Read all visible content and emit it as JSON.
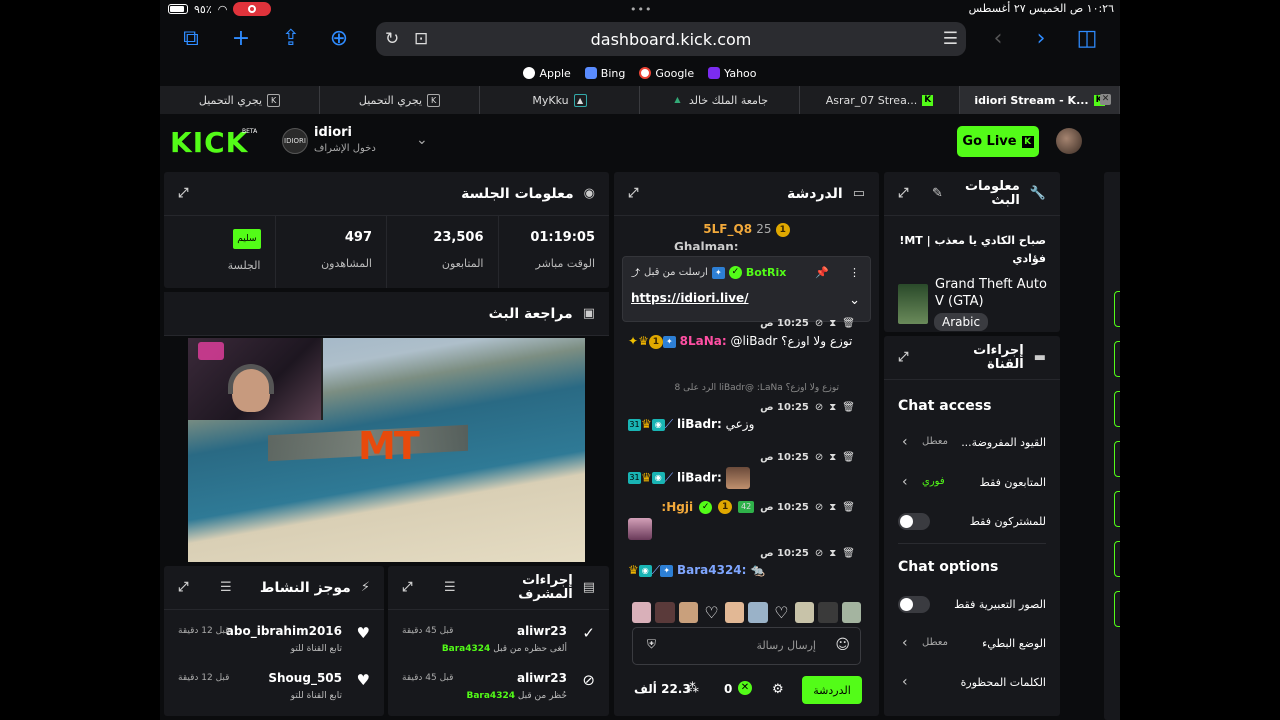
{
  "status": {
    "battery": "٩٥٪",
    "time_date": "١٠:٢٦ ص   الخميس ٢٧ أغسطس",
    "dots": "•••"
  },
  "browser": {
    "url": "dashboard.kick.com",
    "favorites": [
      {
        "label": "Apple",
        "color": "#ffffff"
      },
      {
        "label": "Bing",
        "color": "#5a8cff"
      },
      {
        "label": "Google",
        "color": "#ea4335"
      },
      {
        "label": "Yahoo",
        "color": "#7b2cf0"
      }
    ],
    "tabs": [
      {
        "label": "يجري التحميل"
      },
      {
        "label": "يجري التحميل"
      },
      {
        "label": "MyKku"
      },
      {
        "label": "جامعة الملك خالد"
      },
      {
        "label": "Asrar_07 Strea..."
      },
      {
        "label": "idiori Stream - K..."
      }
    ]
  },
  "header": {
    "logo": "KICK",
    "beta": "BETA",
    "channel_name": "idiori",
    "channel_sub": "دخول الإشراف",
    "avatar_text": "IDIORI",
    "go_live": "Go Live",
    "kick_k": "K"
  },
  "session": {
    "title": "معلومات الجلسة",
    "stats": [
      {
        "value": "01:19:05",
        "label": "الوقت مباشر"
      },
      {
        "value": "23,506",
        "label": "المتابعون"
      },
      {
        "value": "497",
        "label": "المشاهدون"
      },
      {
        "value": "سليم",
        "label": "الجلسة"
      }
    ]
  },
  "preview": {
    "title": "مراجعة البث",
    "overlay": "MT"
  },
  "activity": {
    "title": "موجز النشاط",
    "items": [
      {
        "name": "abo_ibrahim2016",
        "sub": "تابع القناة للتو",
        "time": "قبل 12 دقيقة"
      },
      {
        "name": "Shoug_505",
        "sub": "تابع القناة للتو",
        "time": "قبل 12 دقيقة"
      }
    ]
  },
  "modactions": {
    "title": "إجراءات المشرف",
    "items": [
      {
        "name": "aliwr23",
        "target": "Bara4324",
        "sub": "ألغى حظره من قبل",
        "time": "قبل 45 دقيقة"
      },
      {
        "name": "aliwr23",
        "target": "Bara4324",
        "sub": "حُظر من قبل",
        "time": "قبل 45 دقيقة"
      }
    ]
  },
  "chat": {
    "title": "الدردشة",
    "top_user": "5LF_Q8",
    "top_count": "25",
    "cut_user": "Ghalman:",
    "pinned": {
      "sender": "BotRix",
      "note": "ارسلت من قبل",
      "link": "https://idiori.live/"
    },
    "messages": [
      {
        "time": "10:25 ص",
        "user": "8LaNa:",
        "text": "@liBadr توزع ولا اوزع؟",
        "user_color": "#ff4fa3"
      },
      {
        "time": "10:25 ص",
        "user": "liBadr:",
        "text": "وزعي",
        "user_color": "#ffffff"
      },
      {
        "time": "10:25 ص",
        "user": "liBadr:",
        "text": "",
        "user_color": "#ffffff"
      },
      {
        "time": "10:25 ص",
        "user": "Hgji:",
        "text": "",
        "user_color": "#f2a93b"
      },
      {
        "time": "10:25 ص",
        "user": "Bara4324:",
        "text": "",
        "user_color": "#7fa6ff"
      }
    ],
    "reply": "توزع ولا اوزع؟ liBadr@ :LaNa الرد على 8",
    "placeholder": "إرسال رسالة",
    "send_label": "الدردشة",
    "viewers": "22.3 ألف",
    "zero": "0",
    "badge_31": "31",
    "badge_42": "42",
    "coin_1": "1"
  },
  "streaminfo": {
    "title": "معلومات البث",
    "stream_title": "صباح الكادي يا معذب | MT! فؤادي",
    "category": "Grand Theft Auto V (GTA)",
    "language": "Arabic"
  },
  "channel_actions": {
    "title": "إجراءات القناة",
    "chat_access": "Chat access",
    "access": [
      {
        "label": "القيود المفروضة...",
        "value": "معطل",
        "type": "arrow"
      },
      {
        "label": "المتابعون فقط",
        "value": "فوري",
        "type": "arrow",
        "value_color": "#53fc18"
      },
      {
        "label": "للمشتركون فقط",
        "value": "",
        "type": "toggle"
      }
    ],
    "chat_options": "Chat options",
    "options": [
      {
        "label": "الصور التعبيرية فقط",
        "value": "",
        "type": "toggle"
      },
      {
        "label": "الوضع البطيء",
        "value": "معطل",
        "type": "arrow"
      },
      {
        "label": "الكلمات المحظورة",
        "value": "",
        "type": "arrow"
      }
    ]
  }
}
